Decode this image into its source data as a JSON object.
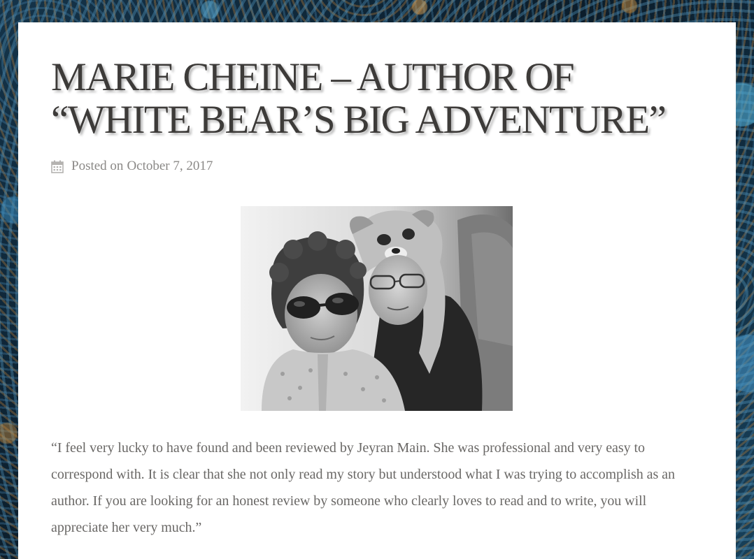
{
  "post": {
    "title_line_1": "MARIE CHEINE – AUTHOR OF",
    "title_line_2": "“WHITE BEAR’S BIG ADVENTURE”",
    "meta_prefix": "Posted on",
    "date": "October 7, 2017",
    "calendar_icon": "calendar-icon",
    "testimonial": "“I feel very lucky to have found and been reviewed by Jeyran Main.  She was professional and very easy to correspond with.  It is clear that she not only read my story but understood what I was trying to accomplish as an author. If you are looking for an honest review by someone who clearly loves to read and to write, you will appreciate her very much.”"
  },
  "colors": {
    "title": "#3d3b39",
    "body_text": "#6a6866",
    "meta_text": "#8a8886",
    "card_bg": "#ffffff",
    "page_bg": "#0f2434"
  }
}
